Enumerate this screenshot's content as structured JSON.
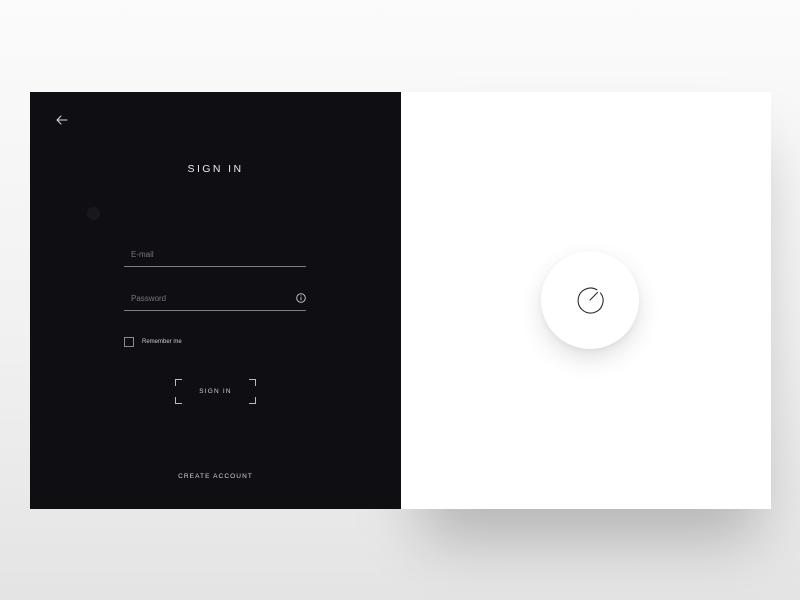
{
  "colors": {
    "panel_dark": "#0e0e13",
    "panel_light": "#ffffff",
    "text_light": "#e9e9ee",
    "line": "#7d7d86"
  },
  "header": {
    "back_icon": "arrow-left-icon",
    "title": "SIGN IN"
  },
  "form": {
    "email": {
      "placeholder": "E-mail",
      "value": ""
    },
    "password": {
      "placeholder": "Password",
      "value": "",
      "icon": "info-icon"
    },
    "remember": {
      "label": "Remember me",
      "checked": false
    },
    "submit_label": "SIGN IN"
  },
  "footer": {
    "create_account_label": "CREATE ACCOUNT"
  },
  "loader": {
    "icon": "spinner-icon"
  }
}
